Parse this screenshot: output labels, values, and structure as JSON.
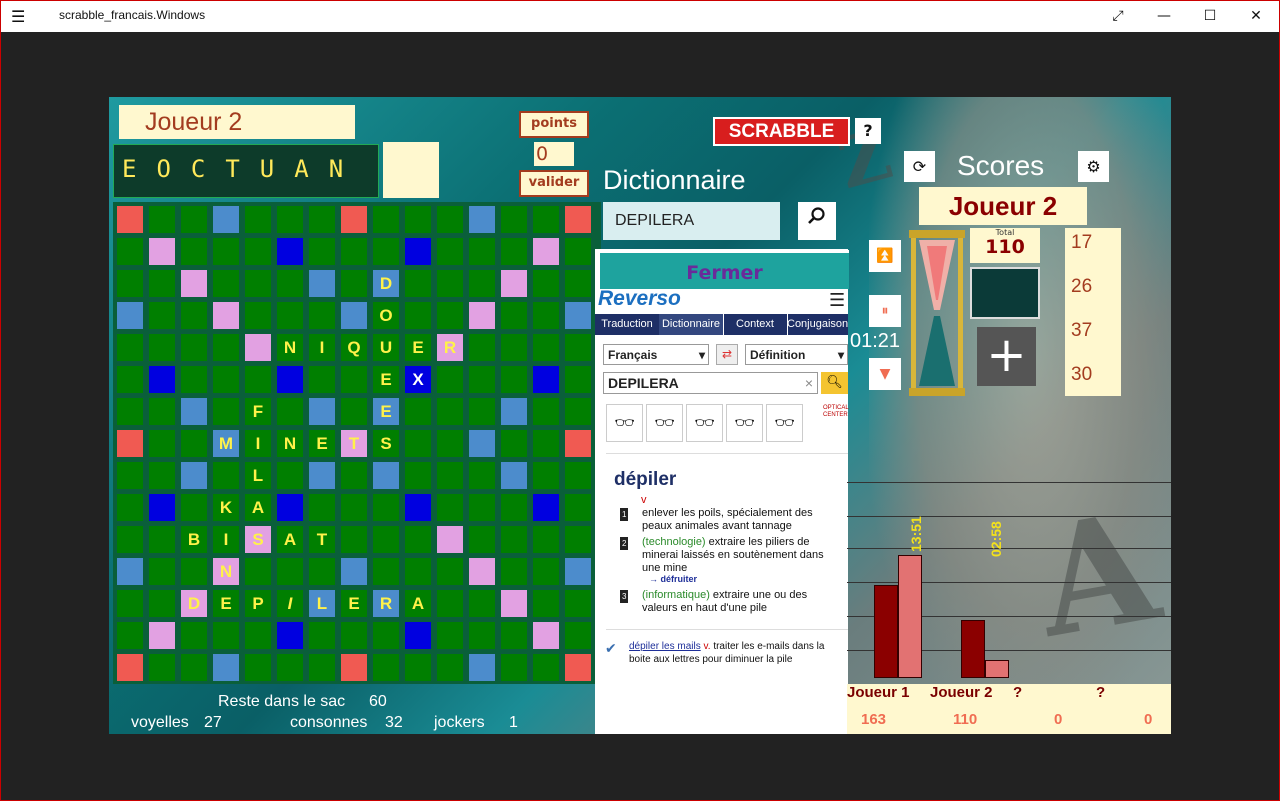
{
  "window": {
    "title": "scrabble_francais.Windows",
    "menu_icon": "hamburger-icon",
    "controls": [
      "fullscreen-icon",
      "minimize-icon",
      "maximize-icon",
      "close-icon"
    ]
  },
  "game": {
    "current_player": "Joueur 2",
    "rack_letters": "EOCTUAN",
    "points_label": "points",
    "points_value": "0",
    "valider_label": "valider"
  },
  "bag": {
    "remaining_label": "Reste dans le sac",
    "remaining_value": "60",
    "vowels_label": "voyelles",
    "vowels_value": "27",
    "consonants_label": "consonnes",
    "consonants_value": "32",
    "jokers_label": "jockers",
    "jokers_value": "1"
  },
  "board": {
    "grid": [
      "RGGLGGGRGGGLGGR",
      "GPGGGBGGGBGGGPG",
      "GGPGGGLGLGGGPGG",
      "LGGPGGGLGGGPGGL",
      "GGGGPGGGGGPGGGG",
      "GBGGGBGGGBGGGBG",
      "GGLGGGLGLGGGLGG",
      "RGGLGGGPGGGLGGR",
      "GGLGGGLGLGGGLGG",
      "GBGGGBGGGBGGGBG",
      "GGGGPGGGGGPGGGG",
      "LGGPGGGLGGGPGGL",
      "GGPGGGLGLGGGPGG",
      "GPGGGBGGGBGGGPG",
      "RGGLGGGRGGGLGGR"
    ],
    "letters": [
      {
        "r": 2,
        "c": 8,
        "ch": "D"
      },
      {
        "r": 3,
        "c": 8,
        "ch": "O"
      },
      {
        "r": 4,
        "c": 5,
        "ch": "N"
      },
      {
        "r": 4,
        "c": 6,
        "ch": "I"
      },
      {
        "r": 4,
        "c": 7,
        "ch": "Q"
      },
      {
        "r": 4,
        "c": 8,
        "ch": "U"
      },
      {
        "r": 4,
        "c": 9,
        "ch": "E"
      },
      {
        "r": 4,
        "c": 10,
        "ch": "R"
      },
      {
        "r": 5,
        "c": 8,
        "ch": "E"
      },
      {
        "r": 5,
        "c": 9,
        "ch": "X",
        "white": true
      },
      {
        "r": 6,
        "c": 4,
        "ch": "F"
      },
      {
        "r": 6,
        "c": 8,
        "ch": "E"
      },
      {
        "r": 7,
        "c": 3,
        "ch": "M"
      },
      {
        "r": 7,
        "c": 4,
        "ch": "I"
      },
      {
        "r": 7,
        "c": 5,
        "ch": "N"
      },
      {
        "r": 7,
        "c": 6,
        "ch": "E"
      },
      {
        "r": 7,
        "c": 7,
        "ch": "T"
      },
      {
        "r": 7,
        "c": 8,
        "ch": "S"
      },
      {
        "r": 8,
        "c": 4,
        "ch": "L"
      },
      {
        "r": 9,
        "c": 3,
        "ch": "K"
      },
      {
        "r": 9,
        "c": 4,
        "ch": "A"
      },
      {
        "r": 10,
        "c": 2,
        "ch": "B"
      },
      {
        "r": 10,
        "c": 3,
        "ch": "I"
      },
      {
        "r": 10,
        "c": 4,
        "ch": "S"
      },
      {
        "r": 10,
        "c": 5,
        "ch": "A"
      },
      {
        "r": 10,
        "c": 6,
        "ch": "T"
      },
      {
        "r": 11,
        "c": 3,
        "ch": "N"
      },
      {
        "r": 12,
        "c": 2,
        "ch": "D"
      },
      {
        "r": 12,
        "c": 3,
        "ch": "E"
      },
      {
        "r": 12,
        "c": 4,
        "ch": "P"
      },
      {
        "r": 12,
        "c": 5,
        "ch": "I",
        "italic": true
      },
      {
        "r": 12,
        "c": 6,
        "ch": "L"
      },
      {
        "r": 12,
        "c": 7,
        "ch": "E"
      },
      {
        "r": 12,
        "c": 8,
        "ch": "R"
      },
      {
        "r": 12,
        "c": 9,
        "ch": "A"
      }
    ]
  },
  "dictionary": {
    "title": "Dictionnaire",
    "query": "DEPILERA",
    "search_icon": "search-icon",
    "close_label": "Fermer",
    "reverso": {
      "logo": "Reverso",
      "menu_icon": "hamburger-icon",
      "tabs": [
        "Traduction",
        "Dictionnaire",
        "Context",
        "Conjugaison"
      ],
      "language": "Français",
      "swap_icon": "swap-icon",
      "mode": "Définition",
      "search_value": "DEPILERA",
      "clear_icon": "×",
      "headword": "dépiler",
      "pos": "v",
      "definitions": [
        {
          "num": "1",
          "domain": "",
          "text": "enlever les poils, spécialement des peaux animales avant tannage"
        },
        {
          "num": "2",
          "domain": "(technologie)",
          "text": "extraire les piliers de minerai laissés en soutènement dans une mine"
        },
        {
          "num": "3",
          "domain": "(informatique)",
          "text": "extraire une ou des valeurs en haut d'une pile"
        }
      ],
      "see_also": "→ défruiter",
      "example_link": "dépiler les mails",
      "example_pos": "v.",
      "example_text": "traiter les e-mails dans la boite aux lettres pour diminuer la pile",
      "ad_label": "OPTICAL CENTER"
    }
  },
  "branding": {
    "logo": "SCRABBLE",
    "help": "?"
  },
  "scores": {
    "title": "Scores",
    "refresh_icon": "refresh-icon",
    "settings_icon": "gear-icon",
    "current_player": "Joueur 2",
    "total_label": "Total",
    "total_value": "110",
    "timer": "01:21",
    "history": [
      "17",
      "26",
      "37",
      "30"
    ],
    "plus_icon": "+"
  },
  "chart_data": {
    "type": "bar",
    "categories": [
      "Joueur 1",
      "Joueur 2",
      "?",
      "?"
    ],
    "series": [
      {
        "values": [
          163,
          110,
          0,
          0
        ],
        "color": "#8b0000"
      },
      {
        "values": [
          163,
          110,
          0,
          0
        ],
        "color": "#e27272"
      }
    ],
    "time_labels": [
      "13:51",
      "02:58",
      "",
      ""
    ],
    "scores": [
      "163",
      "110",
      "0",
      "0"
    ],
    "colors": {
      "dark": "#8b0000",
      "light": "#e27272",
      "time": "#f3e11c",
      "score": "#f06d52"
    }
  }
}
